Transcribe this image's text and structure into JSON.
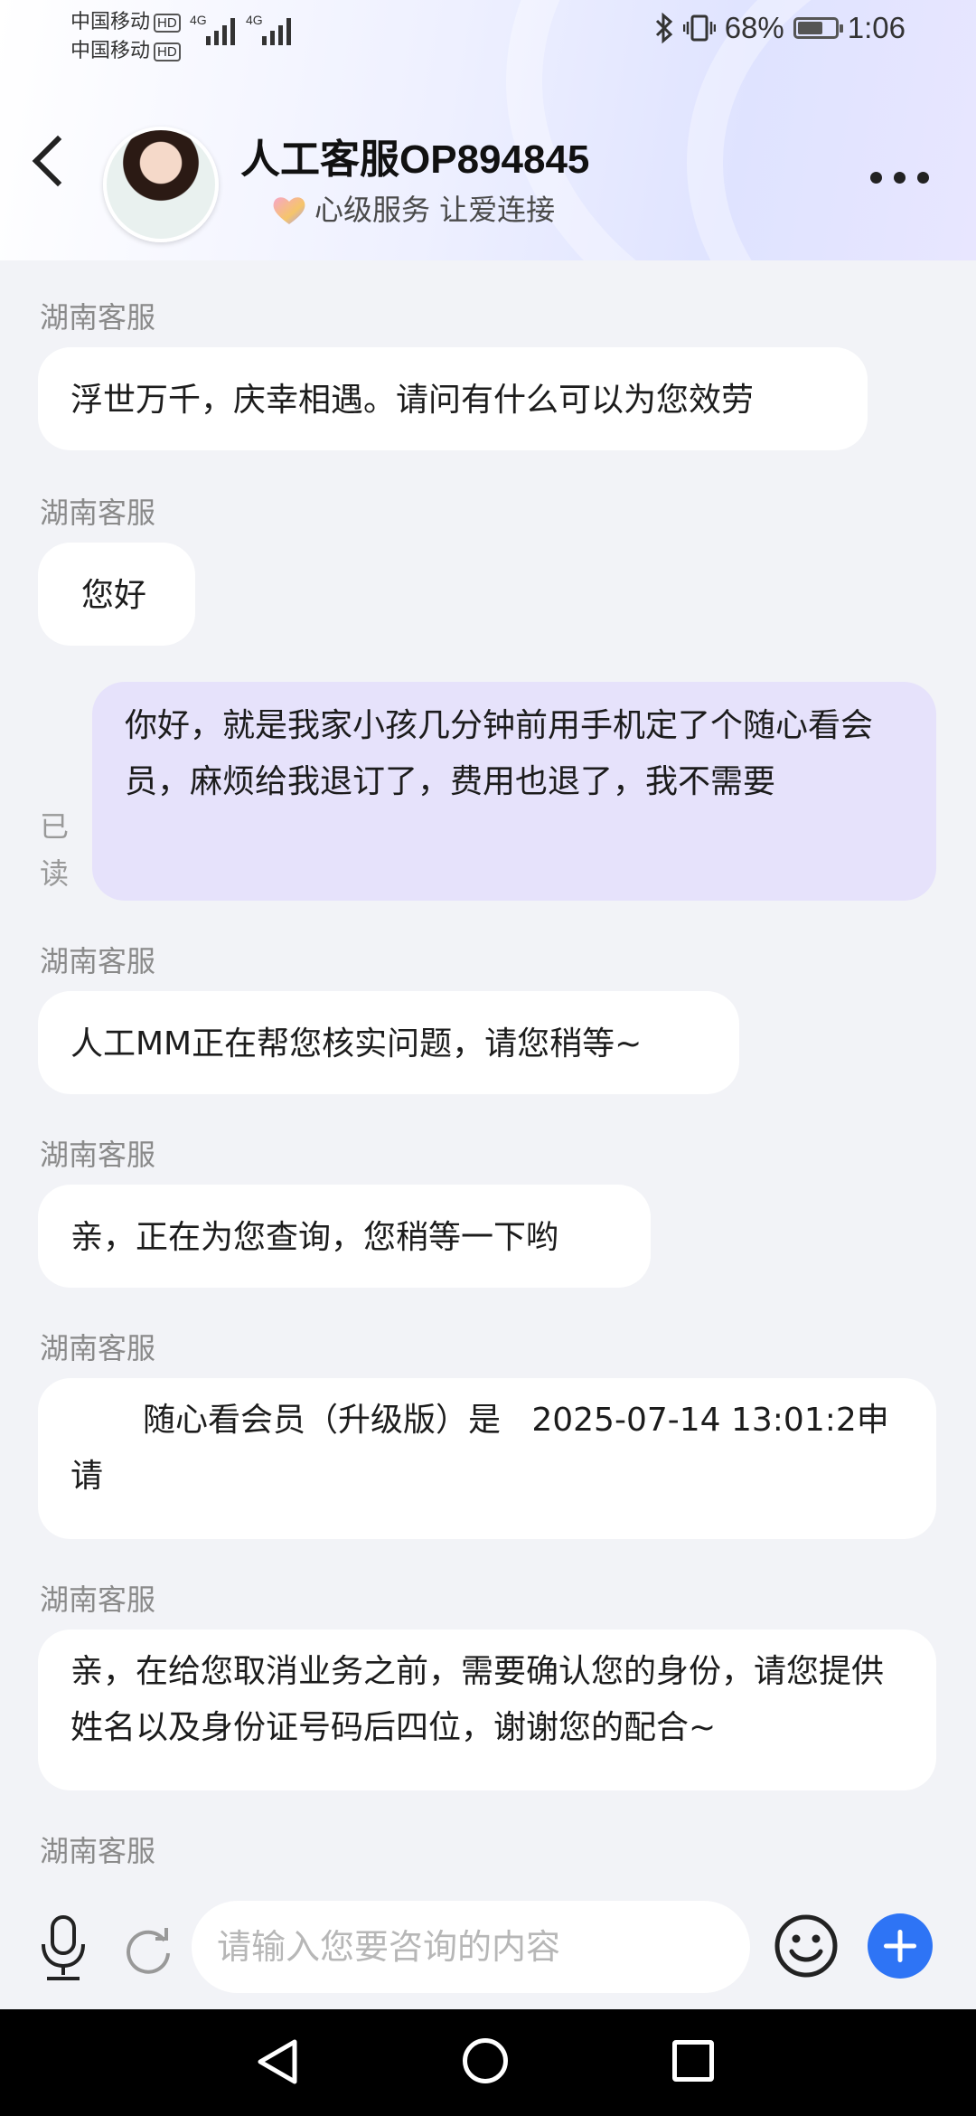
{
  "status_bar": {
    "carrier_1": "中国移动",
    "carrier_2": "中国移动",
    "hd_1": "HD",
    "hd_2": "HD",
    "network_1": "4G",
    "network_2": "4G",
    "battery_percent": "68%",
    "battery_level": 0.68,
    "time": "1:06"
  },
  "header": {
    "title": "人工客服OP894845",
    "subtitle": "心级服务 让爱连接",
    "heart_icon": "heart-icon",
    "more_icon": "more-dots-icon",
    "back_icon": "back-arrow-icon"
  },
  "messages": [
    {
      "sender": "湖南客服",
      "text": "浮世万千，庆幸相遇。请问有什么可以为您效劳"
    },
    {
      "sender": "湖南客服",
      "text": "您好"
    },
    {
      "text": "你好，就是我家小孩几分钟前用手机定了个随心看会员，麻烦给我退订了，费用也退了，我不需要",
      "status": "已读"
    },
    {
      "sender": "湖南客服",
      "text": "人工MM正在帮您核实问题，请您稍等~"
    },
    {
      "sender": "湖南客服",
      "text": "亲，正在为您查询，您稍等一下哟"
    },
    {
      "sender": "湖南客服",
      "text": "随心看会员（升级版）是   2025-07-14 13:01:2申请"
    },
    {
      "sender": "湖南客服",
      "text": "亲，在给您取消业务之前，需要确认您的身份，请您提供姓名以及身份证号码后四位，谢谢您的配合~"
    },
    {
      "sender": "湖南客服"
    }
  ],
  "input_bar": {
    "placeholder": "请输入您要咨询的内容",
    "icons": [
      "microphone-icon",
      "refresh-icon",
      "emoji-icon",
      "plus-icon"
    ]
  },
  "colors": {
    "accent": "#2e74f5",
    "my_bubble": "#e6e2fb",
    "other_bubble": "#ffffff",
    "background": "#f2f3f7"
  }
}
